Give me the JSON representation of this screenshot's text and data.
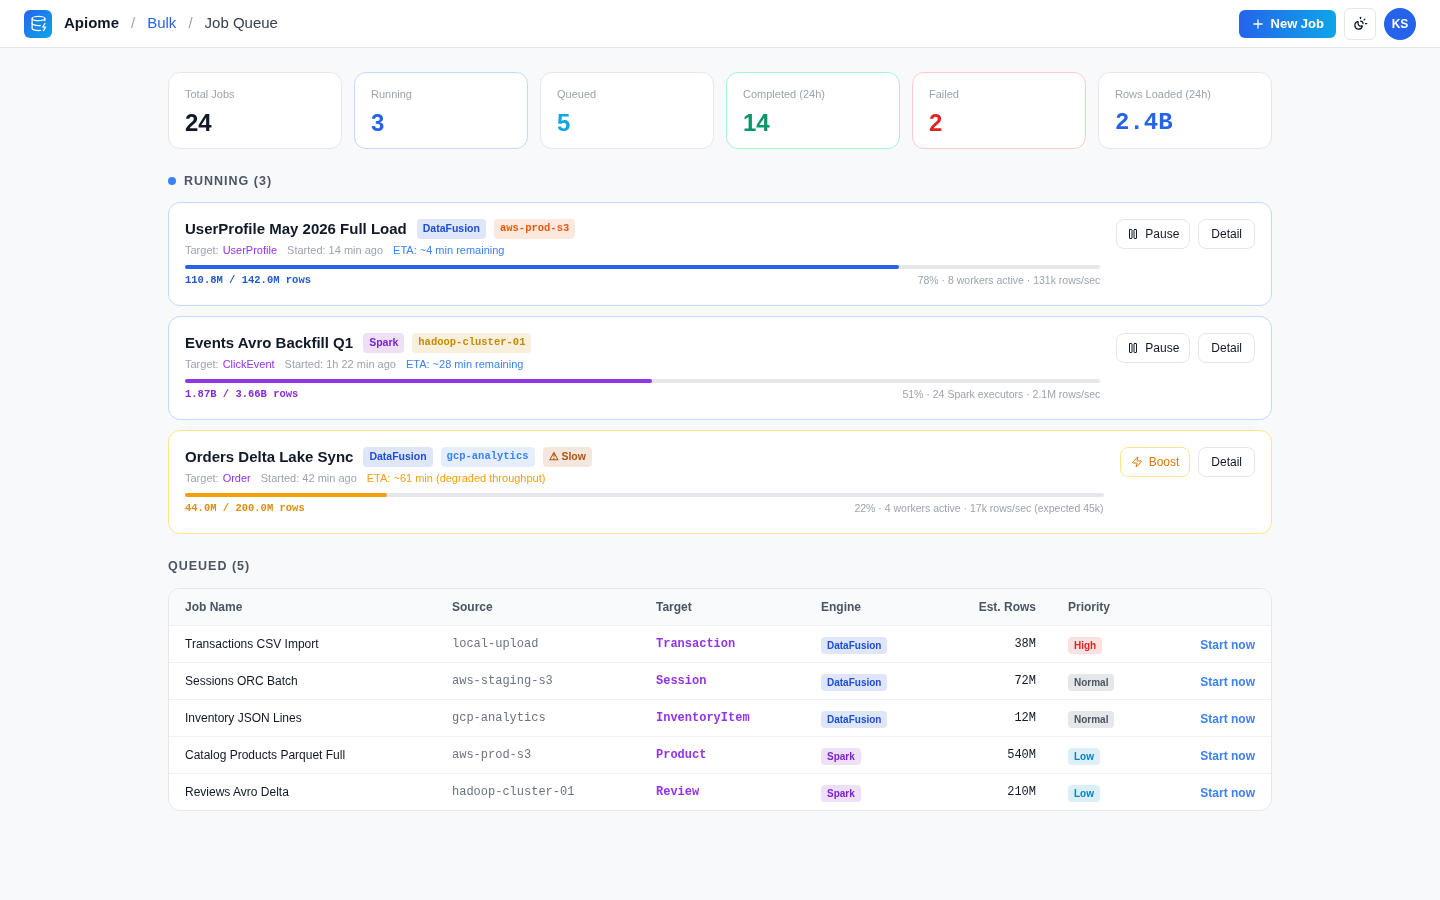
{
  "header": {
    "breadcrumb": [
      {
        "label": "Apiome",
        "kind": "brand"
      },
      {
        "label": "/",
        "kind": "separator"
      },
      {
        "label": "Bulk",
        "kind": "link"
      },
      {
        "label": "/",
        "kind": "separator"
      },
      {
        "label": "Job Queue",
        "kind": "current"
      }
    ],
    "new_job_button": "New Job",
    "avatar": "KS"
  },
  "stats": [
    {
      "label": "Total Jobs",
      "value": "24",
      "kind": "total"
    },
    {
      "label": "Running",
      "value": "3",
      "kind": "running"
    },
    {
      "label": "Queued",
      "value": "5",
      "kind": "queued"
    },
    {
      "label": "Completed (24h)",
      "value": "14",
      "kind": "completed"
    },
    {
      "label": "Failed",
      "value": "2",
      "kind": "failed"
    },
    {
      "label": "Rows Loaded (24h)",
      "value": "2.4B",
      "kind": "rows"
    }
  ],
  "running": {
    "title": "RUNNING (3)",
    "jobs": [
      {
        "title": "UserProfile May 2026 Full Load",
        "tags": [
          {
            "label": "DataFusion",
            "kind": "engine",
            "color": "#1d4ed8"
          },
          {
            "label": "aws-prod-s3",
            "kind": "source",
            "color": "#ea580c"
          }
        ],
        "target_label": "Target:",
        "target": "UserProfile",
        "started": "Started: 14 min ago",
        "eta": "ETA: ~4 min remaining",
        "slow": false,
        "level": 0.78,
        "color": "#2563eb",
        "rows": "110.8M / 142.0M rows",
        "stats": "78% · 8 workers active · 131k rows/sec",
        "buttons": [
          {
            "label": "Pause",
            "kind": "pause"
          },
          {
            "label": "Detail",
            "kind": "detail"
          }
        ]
      },
      {
        "title": "Events Avro Backfill Q1",
        "tags": [
          {
            "label": "Spark",
            "kind": "engine",
            "color": "#7e22ce"
          },
          {
            "label": "hadoop-cluster-01",
            "kind": "source",
            "color": "#ca8a04"
          }
        ],
        "target_label": "Target:",
        "target": "ClickEvent",
        "started": "Started: 1h 22 min ago",
        "eta": "ETA: ~28 min remaining",
        "slow": false,
        "level": 0.51,
        "color": "#9333ea",
        "rows": "1.87B / 3.66B rows",
        "stats": "51% · 24 Spark executors · 2.1M rows/sec",
        "buttons": [
          {
            "label": "Pause",
            "kind": "pause"
          },
          {
            "label": "Detail",
            "kind": "detail"
          }
        ]
      },
      {
        "title": "Orders Delta Lake Sync",
        "tags": [
          {
            "label": "DataFusion",
            "kind": "engine",
            "color": "#1d4ed8"
          },
          {
            "label": "gcp-analytics",
            "kind": "source",
            "color": "#3b82f6"
          },
          {
            "label": "⚠ Slow",
            "kind": "warning",
            "color": "#b45309"
          }
        ],
        "target_label": "Target:",
        "target": "Order",
        "started": "Started: 42 min ago",
        "eta": "ETA: ~61 min (degraded throughput)",
        "slow": true,
        "level": 0.22,
        "color": "#f59e0b",
        "rows": "44.0M / 200.0M rows",
        "stats": "22% · 4 workers active · 17k rows/sec (expected 45k)",
        "buttons": [
          {
            "label": "Boost",
            "kind": "boost"
          },
          {
            "label": "Detail",
            "kind": "detail"
          }
        ]
      }
    ]
  },
  "queued": {
    "title": "QUEUED (5)",
    "columns": [
      "Job Name",
      "Source",
      "Target",
      "Engine",
      "Est. Rows",
      "Priority"
    ],
    "rows": [
      {
        "name": "Transactions CSV Import",
        "source": "local-upload",
        "target": "Transaction",
        "engine": {
          "label": "DataFusion",
          "color": "#1d4ed8"
        },
        "est_rows": "38M",
        "priority": {
          "label": "High",
          "color": "#dc2626"
        },
        "action": "Start now"
      },
      {
        "name": "Sessions ORC Batch",
        "source": "aws-staging-s3",
        "target": "Session",
        "engine": {
          "label": "DataFusion",
          "color": "#1d4ed8"
        },
        "est_rows": "72M",
        "priority": {
          "label": "Normal",
          "color": "#4b5563"
        },
        "action": "Start now"
      },
      {
        "name": "Inventory JSON Lines",
        "source": "gcp-analytics",
        "target": "InventoryItem",
        "engine": {
          "label": "DataFusion",
          "color": "#1d4ed8"
        },
        "est_rows": "12M",
        "priority": {
          "label": "Normal",
          "color": "#4b5563"
        },
        "action": "Start now"
      },
      {
        "name": "Catalog Products Parquet Full",
        "source": "aws-prod-s3",
        "target": "Product",
        "engine": {
          "label": "Spark",
          "color": "#7e22ce"
        },
        "est_rows": "540M",
        "priority": {
          "label": "Low",
          "color": "#0284c7"
        },
        "action": "Start now"
      },
      {
        "name": "Reviews Avro Delta",
        "source": "hadoop-cluster-01",
        "target": "Review",
        "engine": {
          "label": "Spark",
          "color": "#7e22ce"
        },
        "est_rows": "210M",
        "priority": {
          "label": "Low",
          "color": "#0284c7"
        },
        "action": "Start now"
      }
    ]
  }
}
